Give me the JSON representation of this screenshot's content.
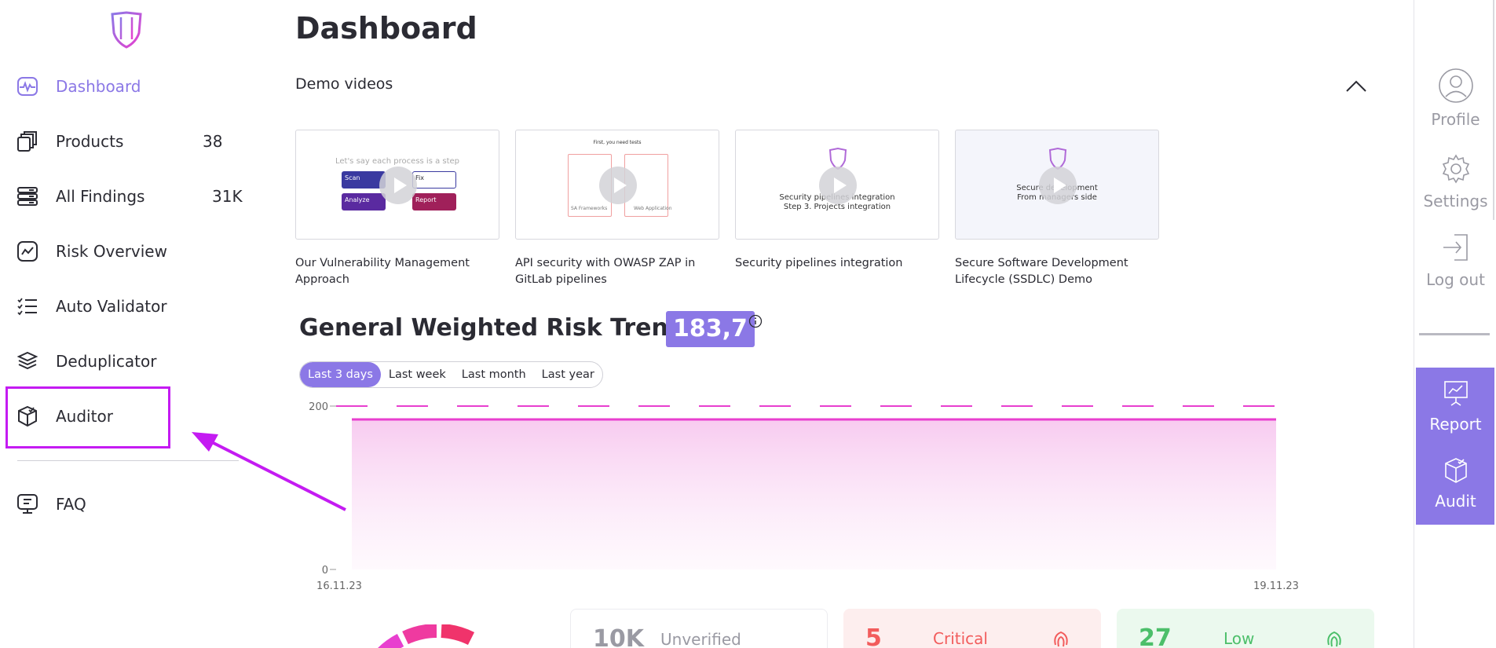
{
  "sidebar": {
    "items": [
      {
        "label": "Dashboard",
        "count": "",
        "icon": "pulse-icon",
        "active": true
      },
      {
        "label": "Products",
        "count": "38",
        "icon": "stack-icon"
      },
      {
        "label": "All Findings",
        "count": "31K",
        "icon": "server-icon"
      },
      {
        "label": "Risk Overview",
        "count": "",
        "icon": "trend-icon"
      },
      {
        "label": "Auto Validator",
        "count": "",
        "icon": "checklist-icon"
      },
      {
        "label": "Deduplicator",
        "count": "",
        "icon": "layers-icon"
      },
      {
        "label": "Auditor",
        "count": "",
        "icon": "cube-check-icon"
      },
      {
        "label": "FAQ",
        "count": "",
        "icon": "monitor-chat-icon"
      }
    ]
  },
  "header": {
    "title": "Dashboard"
  },
  "demo": {
    "section_title": "Demo videos",
    "videos": [
      {
        "title": "Our Vulnerability Management Approach",
        "thumb_lines": [
          "Let's say each process is a step",
          "Scan",
          "Fix",
          "Analyze",
          "Report"
        ]
      },
      {
        "title": "API security with OWASP ZAP in GitLab pipelines",
        "thumb_lines": [
          "First, you need tests",
          "SA Frameworks",
          "Web Application"
        ]
      },
      {
        "title": "Security pipelines integration",
        "thumb_lines": [
          "Security pipelines integration",
          "Step 3. Projects integration"
        ]
      },
      {
        "title": "Secure Software Development Lifecycle (SSDLC) Demo",
        "thumb_lines": [
          "Secure development",
          "From managers side"
        ]
      }
    ]
  },
  "trend": {
    "title": "General Weighted Risk Trend:",
    "value": "183,7",
    "ranges": [
      "Last 3 days",
      "Last week",
      "Last month",
      "Last year"
    ],
    "selected_range": "Last 3 days"
  },
  "chart_data": {
    "type": "area",
    "x": [
      "16.11.23",
      "19.11.23"
    ],
    "y_ticks": [
      "0",
      "200"
    ],
    "ylim": [
      0,
      200
    ],
    "series": [
      {
        "values": [
          183.7,
          183.7
        ],
        "color": "#e83fcf"
      }
    ],
    "threshold": 200,
    "grid": false
  },
  "stats": [
    {
      "value": "10K",
      "label": "Unverified",
      "color": "#9a9aa3",
      "bg": "#ffffff"
    },
    {
      "value": "5",
      "label": "Critical",
      "color": "#f25c5c",
      "bg": "#fdeeee"
    },
    {
      "value": "27",
      "label": "Low",
      "color": "#4cbf6a",
      "bg": "#ebf9ee"
    }
  ],
  "right_panel": {
    "profile": "Profile",
    "settings": "Settings",
    "logout": "Log out",
    "report": "Report",
    "audit": "Audit"
  },
  "colors": {
    "accent": "#8b78e6",
    "highlight": "#c41bf2",
    "trend": "#e83fcf"
  }
}
